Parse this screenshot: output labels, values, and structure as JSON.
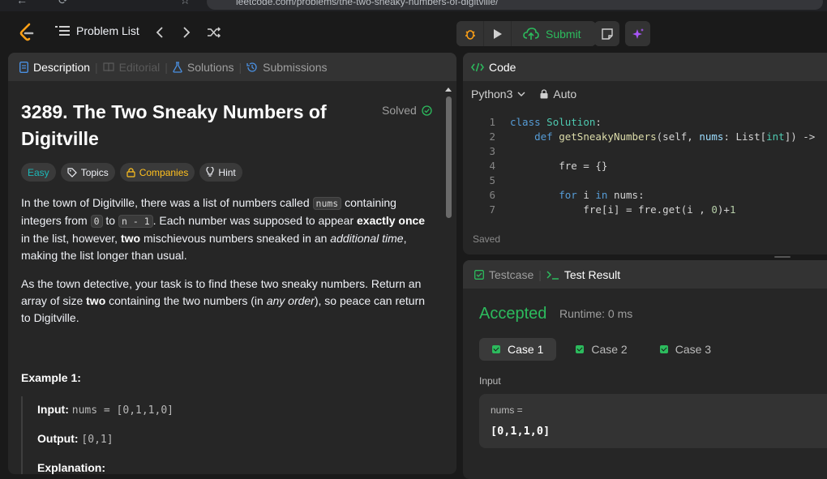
{
  "browser": {
    "url": "leetcode.com/problems/the-two-sneaky-numbers-of-digitville/"
  },
  "topbar": {
    "problem_list_label": "Problem List",
    "submit_label": "Submit"
  },
  "description_panel": {
    "tabs": [
      {
        "label": "Description"
      },
      {
        "label": "Editorial"
      },
      {
        "label": "Solutions"
      },
      {
        "label": "Submissions"
      }
    ],
    "title": "3289. The Two Sneaky Numbers of Digitville",
    "status": "Solved",
    "tags": [
      "Easy",
      "Topics",
      "Companies",
      "Hint"
    ],
    "para1": {
      "t1": "In the town of Digitville, there was a list of numbers called ",
      "c1": "nums",
      "t2": " containing integers from ",
      "c2": "0",
      "t3": " to ",
      "c3": "n - 1",
      "t4": ". Each number was supposed to appear ",
      "b1": "exactly once",
      "t5": " in the list, however, ",
      "b2": "two",
      "t6": " mischievous numbers sneaked in an ",
      "i1": "additional time",
      "t7": ", making the list longer than usual."
    },
    "para2": {
      "t1": "As the town detective, your task is to find these two sneaky numbers. Return an array of size ",
      "b1": "two",
      "t2": " containing the two numbers (in ",
      "i1": "any order",
      "t3": "), so peace can return to Digitville."
    },
    "example_title": "Example 1:",
    "example": {
      "input_label": "Input:",
      "input_value": "nums = [0,1,1,0]",
      "output_label": "Output:",
      "output_value": "[0,1]",
      "explanation_label": "Explanation:"
    }
  },
  "code_panel": {
    "title": "Code",
    "language": "Python3",
    "mode": "Auto",
    "line_numbers": [
      "1",
      "2",
      "3",
      "4",
      "5",
      "6",
      "7"
    ],
    "saved_label": "Saved"
  },
  "test_panel": {
    "tabs": [
      {
        "label": "Testcase"
      },
      {
        "label": "Test Result"
      }
    ],
    "result": "Accepted",
    "runtime": "Runtime: 0 ms",
    "cases": [
      "Case 1",
      "Case 2",
      "Case 3"
    ],
    "input_label": "Input",
    "input_var": "nums =",
    "input_value": "[0,1,1,0]"
  },
  "colors": {
    "accent_green": "#2cbb5d",
    "easy_teal": "#1cb8b8",
    "companies_gold": "#ffc01e"
  }
}
